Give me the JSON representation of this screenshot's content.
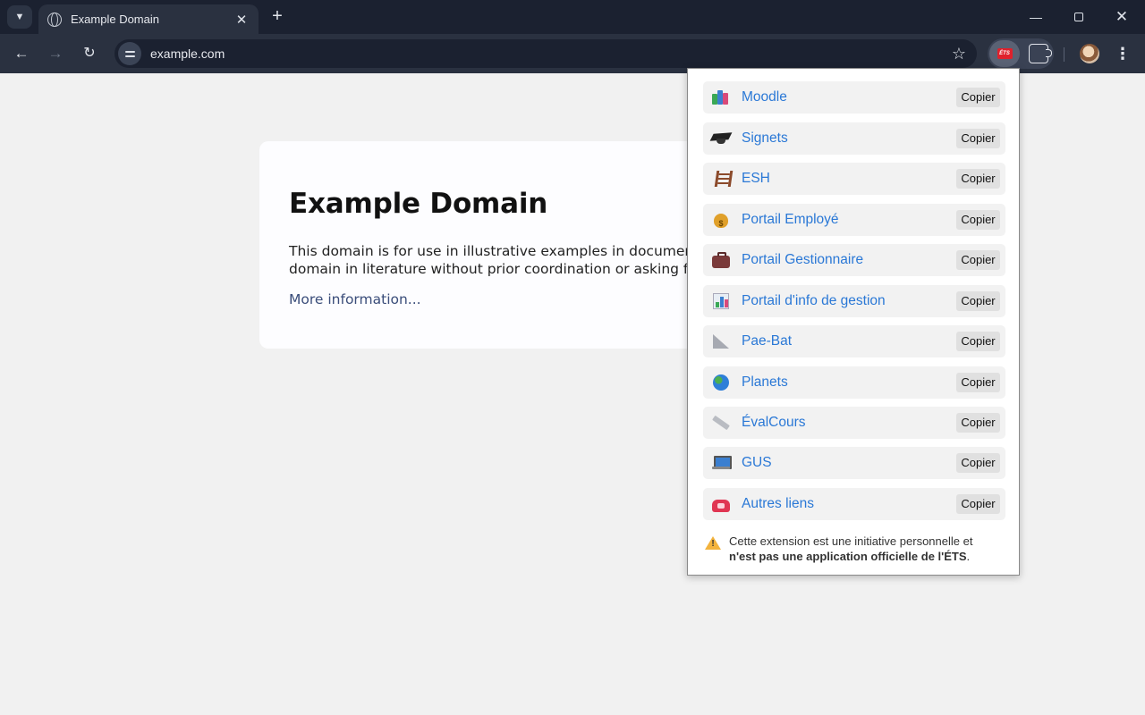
{
  "browser": {
    "tab_title": "Example Domain",
    "url": "example.com",
    "ets_badge": "ÉTS"
  },
  "page": {
    "heading": "Example Domain",
    "paragraph": "This domain is for use in illustrative examples in documents. You may use this domain in literature without prior coordination or asking for permission.",
    "link": "More information..."
  },
  "popup": {
    "links": [
      {
        "label": "Moodle",
        "icon": "books-icon",
        "copy": "Copier"
      },
      {
        "label": "Signets",
        "icon": "graduation-cap-icon",
        "copy": "Copier"
      },
      {
        "label": "ESH",
        "icon": "ladder-icon",
        "copy": "Copier"
      },
      {
        "label": "Portail Employé",
        "icon": "money-bag-icon",
        "copy": "Copier"
      },
      {
        "label": "Portail Gestionnaire",
        "icon": "briefcase-icon",
        "copy": "Copier"
      },
      {
        "label": "Portail d'info de gestion",
        "icon": "bar-chart-icon",
        "copy": "Copier"
      },
      {
        "label": "Pae-Bat",
        "icon": "triangle-ruler-icon",
        "copy": "Copier"
      },
      {
        "label": "Planets",
        "icon": "globe-icon",
        "copy": "Copier"
      },
      {
        "label": "ÉvalCours",
        "icon": "ruler-icon",
        "copy": "Copier"
      },
      {
        "label": "GUS",
        "icon": "laptop-icon",
        "copy": "Copier"
      },
      {
        "label": "Autres liens",
        "icon": "telephone-icon",
        "copy": "Copier"
      }
    ],
    "notice_line1": "Cette extension est une initiative personnelle et",
    "notice_bold": "n'est pas une application officielle de l'ÉTS",
    "notice_end": "."
  }
}
